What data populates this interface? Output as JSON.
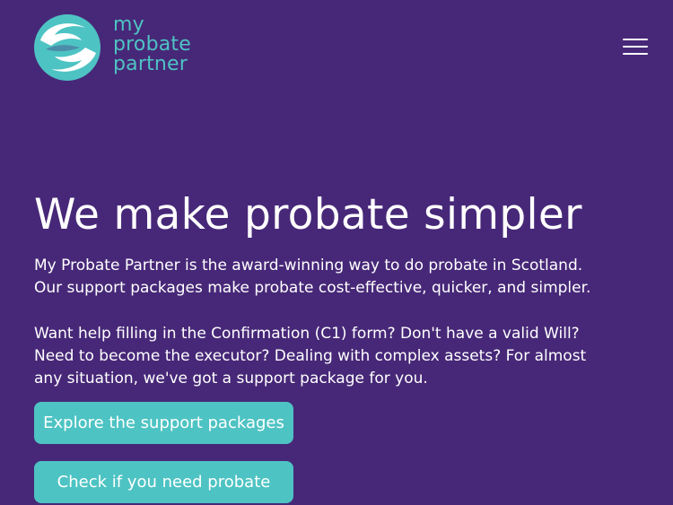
{
  "brand": {
    "logo_lines": [
      "my",
      "probate",
      "partner"
    ],
    "accent_color": "#4ec3c3",
    "background_color": "#472878"
  },
  "header": {
    "menu_icon": "hamburger-menu-icon"
  },
  "hero": {
    "title": "We make probate simpler",
    "para1_line1": "My Probate Partner is the award-winning way to do probate in Scotland.",
    "para1_line2": "Our support packages make probate cost-effective, quicker, and simpler.",
    "para2_line1": "Want help filling in the Confirmation (C1) form? Don't have a valid Will?",
    "para2_line2": "Need to become the executor? Dealing with complex assets? For almost",
    "para2_line3": "any situation, we've got a support package for you."
  },
  "buttons": {
    "explore_label": "Explore the support packages",
    "check_label": "Check if you need probate"
  }
}
